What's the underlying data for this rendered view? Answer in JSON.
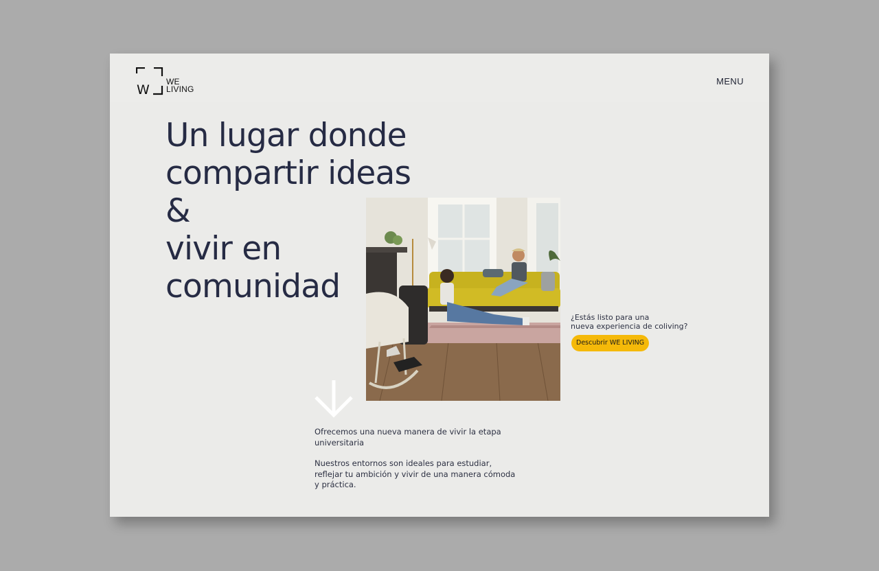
{
  "header": {
    "logo": {
      "mark_letter": "W",
      "line1": "WE",
      "line2": "LIVING"
    },
    "menu_label": "MENU"
  },
  "hero": {
    "title_lines": [
      "Un lugar donde",
      "compartir ideas",
      "&",
      "vivir en",
      "comunidad"
    ]
  },
  "cta": {
    "question_lines": [
      "¿Estás listo para una",
      "nueva experiencia de coliving?"
    ],
    "button_label": "Descubrir WE LIVING",
    "button_color": "#f5b909"
  },
  "scroll_indicator": {
    "icon": "arrow-down-icon"
  },
  "intro": {
    "paragraph1": "Ofrecemos una nueva manera de vivir la etapa universitaria",
    "paragraph2": "Nuestros entornos son ideales para estudiar, reflejar tu ambición y vivir de una manera cómoda y práctica."
  },
  "colors": {
    "page_background": "#ebebe9",
    "title_color": "#262b44",
    "outer_background": "#ababab"
  }
}
